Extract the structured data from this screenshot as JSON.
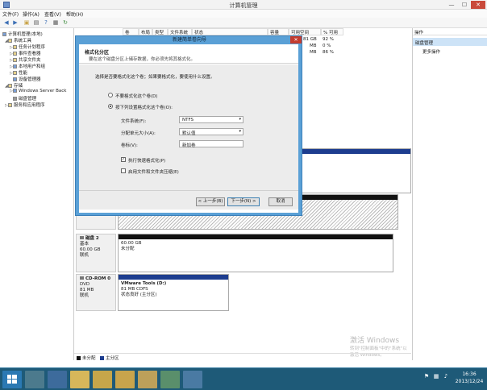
{
  "window": {
    "title": "计算机管理",
    "minimize_glyph": "—",
    "maximize_glyph": "☐",
    "close_glyph": "✕"
  },
  "menu": [
    "文件(F)",
    "操作(A)",
    "查看(V)",
    "帮助(H)"
  ],
  "toolbar": {
    "icons": [
      "back-arrow-icon",
      "forward-arrow-icon",
      "up-folder-icon",
      "show-tree-icon",
      "help-icon",
      "properties-icon",
      "refresh-icon"
    ]
  },
  "tree": {
    "root": "计算机管理(本地)",
    "system_tools": "系统工具",
    "items": [
      "任务计划程序",
      "事件查看器",
      "共享文件夹",
      "本地用户和组",
      "性能",
      "设备管理器"
    ],
    "storage": "存储",
    "backup": "Windows Server Back",
    "disk_mgmt": "磁盘管理",
    "services": "服务和应用程序"
  },
  "volume_table": {
    "headers": [
      "卷",
      "布局",
      "类型",
      "文件系统",
      "状态",
      "容量",
      "可用空间",
      "% 可用"
    ],
    "rows": [
      {
        "free": "81 GB",
        "pct": "92 %"
      },
      {
        "free": "MB",
        "pct": "0 %"
      },
      {
        "free": "MB",
        "pct": "86 %"
      }
    ]
  },
  "disks": [
    {
      "name": "磁盘 2",
      "type": "基本",
      "size": "60.00 GB",
      "status": "联机",
      "part_size": "60.00 GB",
      "part_status": "未分配"
    },
    {
      "name": "CD-ROM 0",
      "type": "DVD",
      "size": "81 MB",
      "status": "联机",
      "part_name": "VMware Tools  (D:)",
      "part_size": "81 MB CDFS",
      "part_status": "状态良好 (主分区)"
    }
  ],
  "legend": {
    "unallocated": "未分配",
    "primary": "主分区",
    "colors": {
      "unallocated": "#111111",
      "primary": "#1d3d8f"
    }
  },
  "actions": {
    "header": "操作",
    "selected": "磁盘管理",
    "more": "更多操作"
  },
  "watermark": {
    "line1": "激活 Windows",
    "line2": "转到\"控制面板\"中的\"系统\"以激活 Windows。"
  },
  "taskbar": {
    "time": "16:36",
    "date": "2013/12/24"
  },
  "dialog": {
    "title": "新建简单卷向导",
    "close_glyph": "✕",
    "heading": "格式化分区",
    "subheading": "要在这个磁盘分区上储存数据，你必须先将其格式化。",
    "prompt": "选择是否要格式化这个卷；如果要格式化，要使用什么设置。",
    "radio_no_format": "不要格式化这个卷(D)",
    "radio_format": "按下列设置格式化这个卷(O):",
    "fs_label": "文件系统(F):",
    "fs_value": "NTFS",
    "alloc_label": "分配单元大小(A):",
    "alloc_value": "默认值",
    "volname_label": "卷标(V):",
    "volname_value": "新加卷",
    "quick_format": "执行快速格式化(P)",
    "compression": "启用文件和文件夹压缩(E)",
    "back": "< 上一步(B)",
    "next": "下一步(N) >",
    "cancel": "取消"
  }
}
